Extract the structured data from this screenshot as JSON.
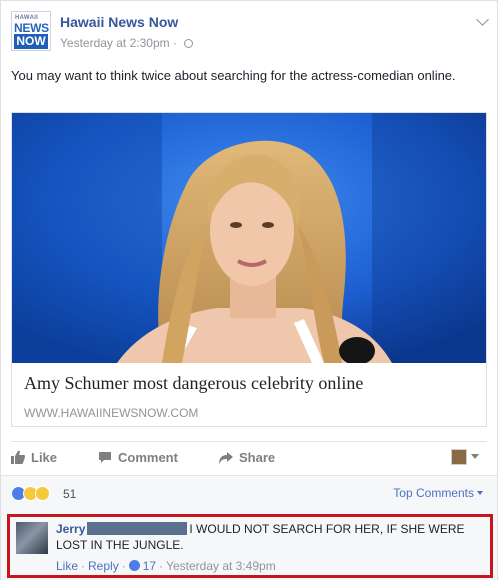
{
  "post": {
    "page_name": "Hawaii News Now",
    "logo": {
      "small": "HAWAII",
      "top": "NEWS",
      "bottom": "NOW"
    },
    "time": "Yesterday at 2:30pm",
    "separator": "·",
    "privacy_icon": "globe-icon",
    "text": "You may want to think twice about searching for the actress-comedian online."
  },
  "link": {
    "title": "Amy Schumer most dangerous celebrity online",
    "domain": "WWW.HAWAIINEWSNOW.COM"
  },
  "actions": {
    "like": "Like",
    "comment": "Comment",
    "share": "Share"
  },
  "reactions": {
    "icons": [
      "like-icon",
      "haha-icon",
      "wow-icon"
    ],
    "count": "51",
    "sort_label": "Top Comments"
  },
  "comment": {
    "author": "Jerry",
    "text": "I WOULD NOT SEARCH FOR HER, IF SHE WERE LOST IN THE JUNGLE.",
    "like": "Like",
    "reply": "Reply",
    "like_count": "17",
    "time": "Yesterday at 3:49pm",
    "separator": "·"
  },
  "colors": {
    "link_blue": "#365899",
    "meta_gray": "#90949c",
    "highlight_red": "#c4161c",
    "photo_blue": "#1e63d6"
  }
}
